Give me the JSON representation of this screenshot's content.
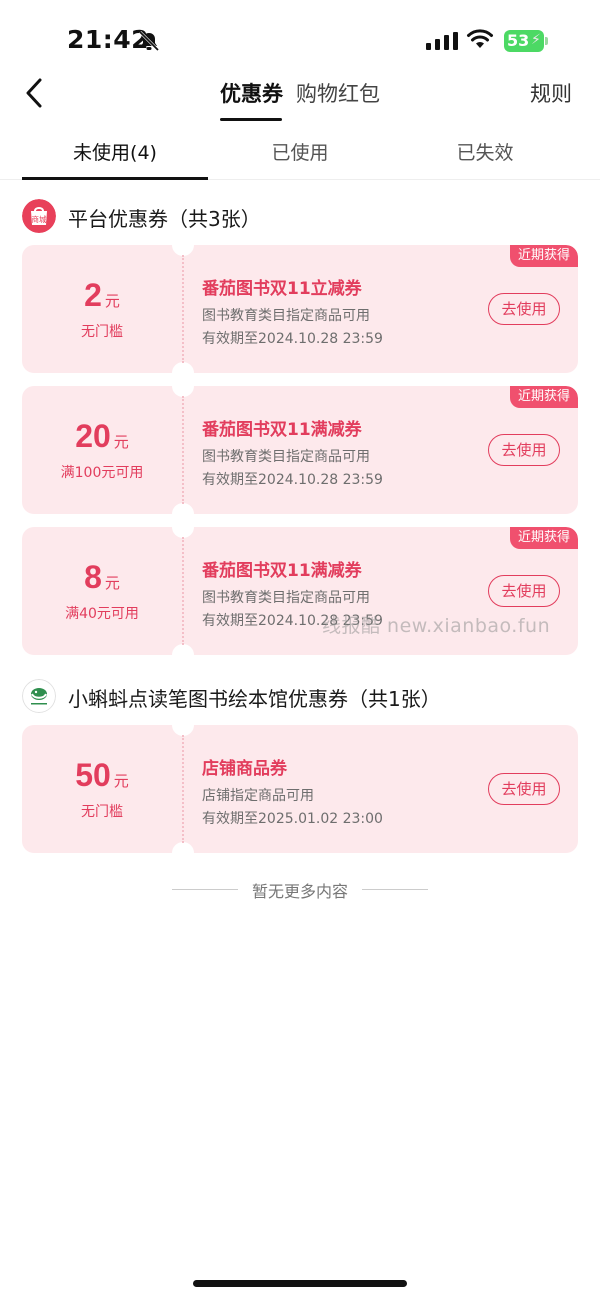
{
  "status_bar": {
    "time": "21:42",
    "battery": "53"
  },
  "header": {
    "tabs": [
      {
        "label": "优惠券",
        "active": true
      },
      {
        "label": "购物红包",
        "active": false
      }
    ],
    "rules_label": "规则"
  },
  "subtabs": [
    {
      "label": "未使用(4)",
      "active": true
    },
    {
      "label": "已使用",
      "active": false
    },
    {
      "label": "已失效",
      "active": false
    }
  ],
  "sections": [
    {
      "icon_label": "商城",
      "title": "平台优惠券（共3张）",
      "coupons": [
        {
          "amount": "2",
          "unit": "元",
          "condition": "无门槛",
          "title": "番茄图书双11立减券",
          "desc": "图书教育类目指定商品可用",
          "expiry": "有效期至2024.10.28 23:59",
          "button": "去使用",
          "badge": "近期获得"
        },
        {
          "amount": "20",
          "unit": "元",
          "condition": "满100元可用",
          "title": "番茄图书双11满减券",
          "desc": "图书教育类目指定商品可用",
          "expiry": "有效期至2024.10.28 23:59",
          "button": "去使用",
          "badge": "近期获得"
        },
        {
          "amount": "8",
          "unit": "元",
          "condition": "满40元可用",
          "title": "番茄图书双11满减券",
          "desc": "图书教育类目指定商品可用",
          "expiry": "有效期至2024.10.28 23:59",
          "button": "去使用",
          "badge": "近期获得"
        }
      ]
    },
    {
      "title": "小蝌蚪点读笔图书绘本馆优惠券（共1张）",
      "coupons": [
        {
          "amount": "50",
          "unit": "元",
          "condition": "无门槛",
          "title": "店铺商品券",
          "desc": "店铺指定商品可用",
          "expiry": "有效期至2025.01.02 23:00",
          "button": "去使用"
        }
      ]
    }
  ],
  "footer": {
    "no_more": "暂无更多内容"
  },
  "watermark": "线报酷 new.xianbao.fun",
  "colors": {
    "accent": "#e23d5d",
    "card_bg": "#fde9ec",
    "badge_bg": "#f0506e",
    "battery": "#4cd964"
  }
}
